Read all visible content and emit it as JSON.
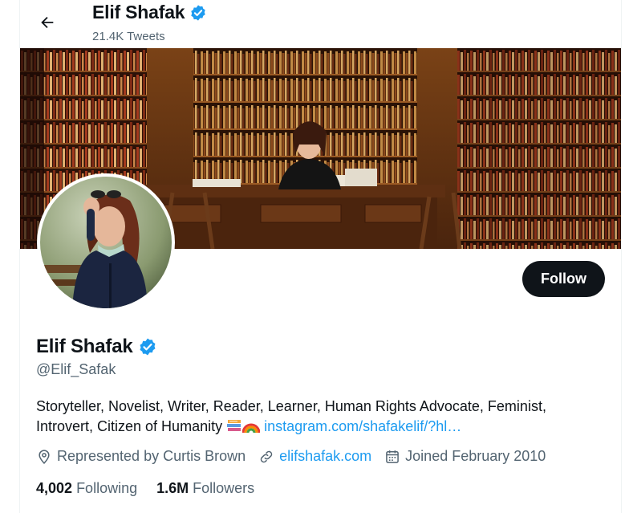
{
  "header": {
    "title": "Elif Shafak",
    "tweet_count": "21.4K Tweets"
  },
  "profile": {
    "name": "Elif Shafak",
    "handle": "@Elif_Safak",
    "follow_label": "Follow",
    "bio_text": "Storyteller, Novelist, Writer, Reader, Learner, Human Rights Advocate, Feminist, Introvert, Citizen of Humanity",
    "bio_link": "instagram.com/shafakelif/?hl…",
    "location": "Represented by Curtis Brown",
    "website": "elifshafak.com",
    "joined": "Joined February 2010"
  },
  "stats": {
    "following_count": "4,002",
    "following_label": "Following",
    "followers_count": "1.6M",
    "followers_label": "Followers"
  },
  "colors": {
    "accent": "#1d9bf0",
    "text": "#0f1419",
    "secondary": "#536471",
    "verified": "#1d9bf0"
  }
}
